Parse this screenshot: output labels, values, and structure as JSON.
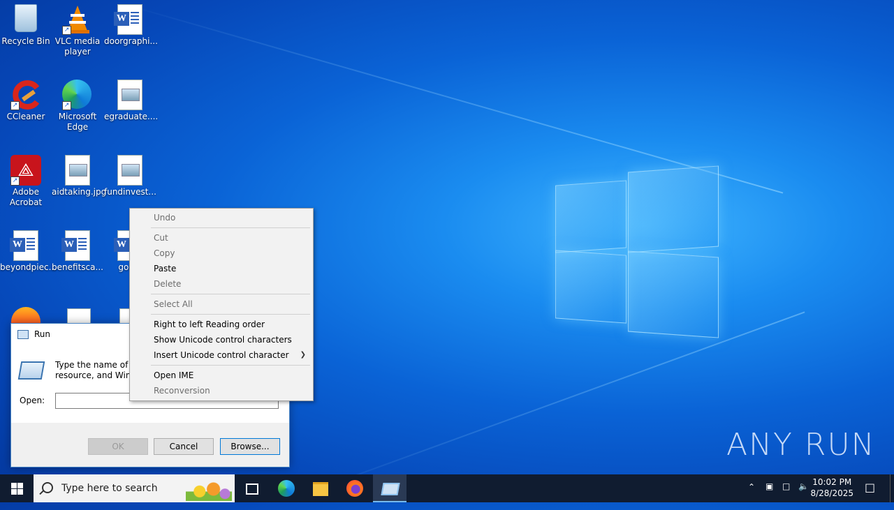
{
  "desktop_icons": [
    {
      "label": "Recycle Bin"
    },
    {
      "label": "VLC media player"
    },
    {
      "label": "doorgraphi..."
    },
    {
      "label": "CCleaner"
    },
    {
      "label": "Microsoft Edge"
    },
    {
      "label": "egraduate...."
    },
    {
      "label": "Adobe Acrobat"
    },
    {
      "label": "aidtaking.jpg"
    },
    {
      "label": "fundinvest..."
    },
    {
      "label": "beyondpiec..."
    },
    {
      "label": "benefitsca..."
    },
    {
      "label": "googl"
    }
  ],
  "run_dialog": {
    "title": "Run",
    "description_line1": "Type the name of a p",
    "description_line2": "resource, and Windo",
    "open_label": "Open:",
    "open_value": "",
    "ok_label": "OK",
    "cancel_label": "Cancel",
    "browse_label": "Browse..."
  },
  "context_menu": {
    "undo": "Undo",
    "cut": "Cut",
    "copy": "Copy",
    "paste": "Paste",
    "delete": "Delete",
    "select_all": "Select All",
    "rtl": "Right to left Reading order",
    "show_unicode": "Show Unicode control characters",
    "insert_unicode": "Insert Unicode control character",
    "open_ime": "Open IME",
    "reconversion": "Reconversion"
  },
  "taskbar": {
    "search_placeholder": "Type here to search",
    "time": "10:02 PM",
    "date": "8/28/2025"
  },
  "watermark": "ANY RUN"
}
